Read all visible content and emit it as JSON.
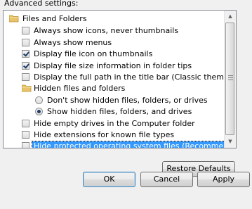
{
  "advanced_settings_label": "Advanced settings:",
  "tree": {
    "items": [
      {
        "type": "folder",
        "label": "Files and Folders"
      },
      {
        "type": "checkbox",
        "checked": false,
        "label": "Always show icons, never thumbnails"
      },
      {
        "type": "checkbox",
        "checked": false,
        "label": "Always show menus"
      },
      {
        "type": "checkbox",
        "checked": true,
        "label": "Display file icon on thumbnails"
      },
      {
        "type": "checkbox",
        "checked": true,
        "label": "Display file size information in folder tips"
      },
      {
        "type": "checkbox",
        "checked": false,
        "label": "Display the full path in the title bar (Classic theme only)"
      },
      {
        "type": "folder",
        "label": "Hidden files and folders"
      },
      {
        "type": "radio",
        "checked": false,
        "label": "Don't show hidden files, folders, or drives"
      },
      {
        "type": "radio",
        "checked": true,
        "label": "Show hidden files, folders, and drives"
      },
      {
        "type": "checkbox",
        "checked": false,
        "label": "Hide empty drives in the Computer folder"
      },
      {
        "type": "checkbox",
        "checked": false,
        "label": "Hide extensions for known file types"
      },
      {
        "type": "checkbox",
        "checked": false,
        "selected": true,
        "label": "Hide protected operating system files (Recommended)"
      }
    ]
  },
  "buttons": {
    "restore_defaults": "Restore Defaults",
    "ok": "OK",
    "cancel": "Cancel",
    "apply": "Apply"
  },
  "colors": {
    "selection": "#3399ff",
    "check": "#1d3b66",
    "folder": "#e8c36a"
  },
  "icons": {
    "folder": "folder-icon",
    "scroll_up": "scroll-up-arrow-icon",
    "scroll_down": "scroll-down-arrow-icon"
  }
}
